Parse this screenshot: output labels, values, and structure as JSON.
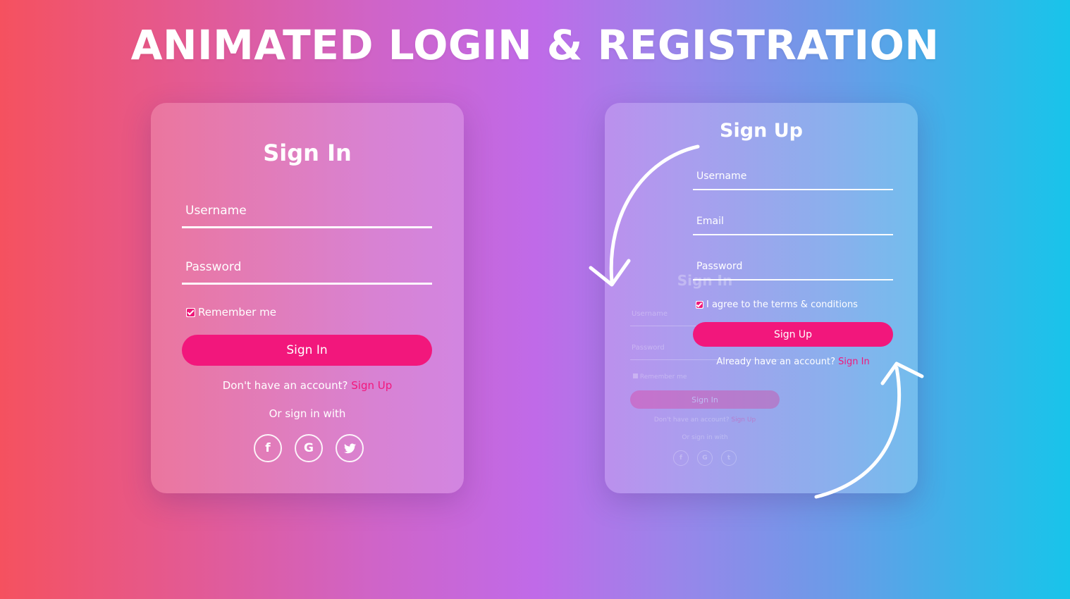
{
  "title": "ANIMATED LOGIN & REGISTRATION",
  "signin": {
    "heading": "Sign In",
    "username_placeholder": "Username",
    "password_placeholder": "Password",
    "remember_label": "Remember me",
    "remember_checked": true,
    "button_label": "Sign In",
    "no_account_text": "Don't have an account?",
    "signup_link": "Sign Up",
    "or_text": "Or sign in with",
    "social": [
      {
        "icon": "facebook-icon",
        "glyph": "f"
      },
      {
        "icon": "google-icon",
        "glyph": "G"
      },
      {
        "icon": "twitter-icon",
        "glyph": "t"
      }
    ]
  },
  "signup": {
    "heading": "Sign Up",
    "username_placeholder": "Username",
    "email_placeholder": "Email",
    "password_placeholder": "Password",
    "terms_label": "I agree to the terms & conditions",
    "terms_checked": true,
    "button_label": "Sign Up",
    "have_account_text": "Already have an account?",
    "signin_link": "Sign In"
  },
  "ghost_signin": {
    "heading": "Sign In",
    "username_placeholder": "Username",
    "password_placeholder": "Password",
    "remember_label": "Remember me",
    "button_label": "Sign In",
    "no_account_text": "Don't have an account?",
    "signup_link": "Sign Up",
    "or_text": "Or sign in with",
    "social_glyphs": [
      "f",
      "G",
      "t"
    ]
  },
  "colors": {
    "accent": "#f2177c",
    "background_left": "#f5515f",
    "background_mid": "#c06ae8",
    "background_right": "#18c4ea"
  }
}
